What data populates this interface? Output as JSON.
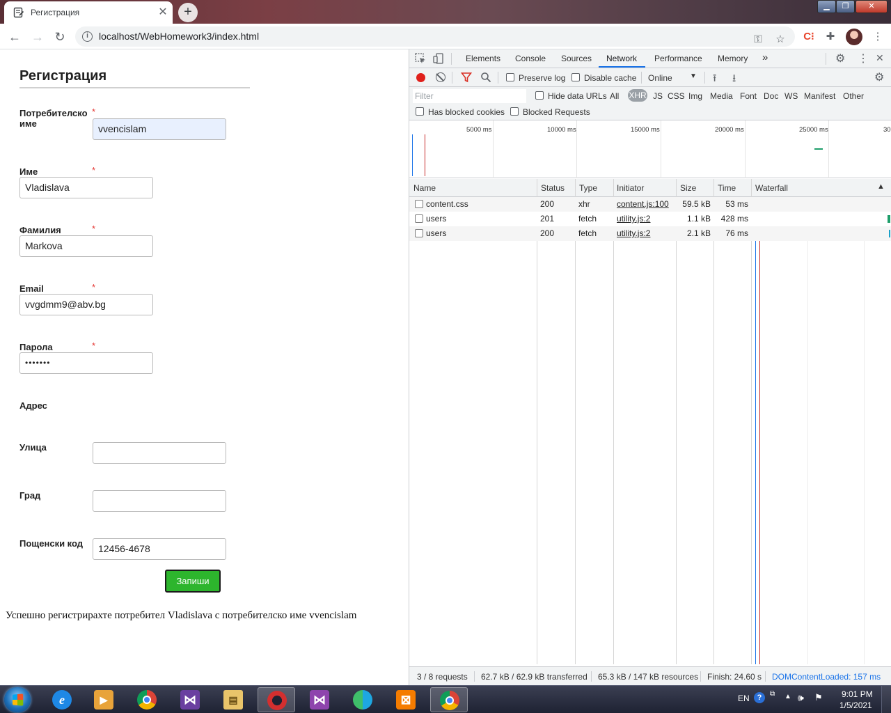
{
  "browser": {
    "tab_title": "Регистрация",
    "url": "localhost/WebHomework3/index.html"
  },
  "form": {
    "title": "Регистрация",
    "required_mark": "*",
    "fields": {
      "username": {
        "label": "Потребителско име",
        "value": "vvencislam"
      },
      "first_name": {
        "label": "Име",
        "value": "Vladislava"
      },
      "last_name": {
        "label": "Фамилия",
        "value": "Markova"
      },
      "email": {
        "label": "Email",
        "value": "vvgdmm9@abv.bg"
      },
      "password": {
        "label": "Парола",
        "value": "•••••••"
      }
    },
    "address_heading": "Адрес",
    "address": {
      "street": {
        "label": "Улица",
        "value": ""
      },
      "city": {
        "label": "Град",
        "value": ""
      },
      "postal": {
        "label": "Пощенски код",
        "value": "12456-4678"
      }
    },
    "submit_label": "Запиши",
    "success_message": "Успешно регистрирахте потребител Vladislava с потребителско име vvencislam"
  },
  "devtools": {
    "tabs": [
      "Elements",
      "Console",
      "Sources",
      "Network",
      "Performance",
      "Memory"
    ],
    "more_tabs": "»",
    "active_tab": "Network",
    "toolbar": {
      "preserve_log": "Preserve log",
      "disable_cache": "Disable cache",
      "throttle": "Online"
    },
    "filter": {
      "placeholder": "Filter",
      "hide_data_urls": "Hide data URLs",
      "types": [
        "All",
        "XHR",
        "JS",
        "CSS",
        "Img",
        "Media",
        "Font",
        "Doc",
        "WS",
        "Manifest",
        "Other"
      ],
      "active_type": "XHR",
      "has_blocked_cookies": "Has blocked cookies",
      "blocked_requests": "Blocked Requests"
    },
    "overview_ticks": [
      "5000 ms",
      "10000 ms",
      "15000 ms",
      "20000 ms",
      "25000 ms",
      "30"
    ],
    "columns": [
      "Name",
      "Status",
      "Type",
      "Initiator",
      "Size",
      "Time",
      "Waterfall"
    ],
    "requests": [
      {
        "name": "content.css",
        "status": "200",
        "type": "xhr",
        "initiator": "content.js:100",
        "size": "59.5 kB",
        "time": "53 ms"
      },
      {
        "name": "users",
        "status": "201",
        "type": "fetch",
        "initiator": "utility.js:2",
        "size": "1.1 kB",
        "time": "428 ms"
      },
      {
        "name": "users",
        "status": "200",
        "type": "fetch",
        "initiator": "utility.js:2",
        "size": "2.1 kB",
        "time": "76 ms"
      }
    ],
    "status": {
      "requests": "3 / 8 requests",
      "transferred": "62.7 kB / 62.9 kB transferred",
      "resources": "65.3 kB / 147 kB resources",
      "finish": "Finish: 24.60 s",
      "dcl": "DOMContentLoaded: 157 ms"
    }
  },
  "taskbar": {
    "language": "EN",
    "time": "9:01 PM",
    "date": "1/5/2021"
  },
  "colors": {
    "accent": "#1a73e8",
    "submit": "#2db52d",
    "required": "#e53935",
    "dcl_line": "#1a73e8",
    "load_line": "#c62828"
  }
}
